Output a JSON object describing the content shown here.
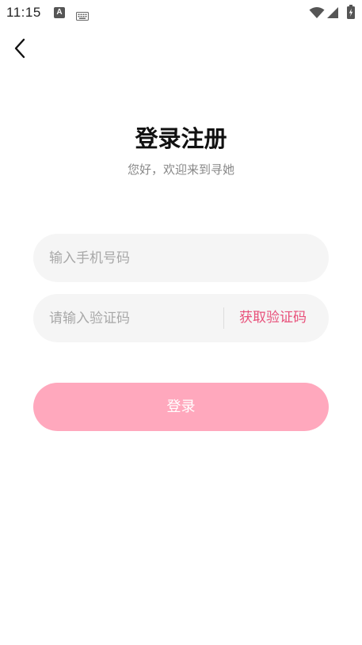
{
  "status_bar": {
    "time": "11:15",
    "app_icon_letter": "A",
    "icons": [
      "a-notification-icon",
      "keyboard-icon",
      "wifi-icon",
      "signal-icon",
      "battery-icon"
    ]
  },
  "nav": {
    "back_icon": "chevron-left-icon"
  },
  "header": {
    "title": "登录注册",
    "subtitle": "您好，欢迎来到寻她"
  },
  "form": {
    "phone_placeholder": "输入手机号码",
    "phone_value": "",
    "code_placeholder": "请输入验证码",
    "code_value": "",
    "get_code_label": "获取验证码",
    "submit_label": "登录"
  },
  "colors": {
    "accent": "#e8507a",
    "button_bg": "#ffa8bd",
    "field_bg": "#f5f5f5"
  }
}
